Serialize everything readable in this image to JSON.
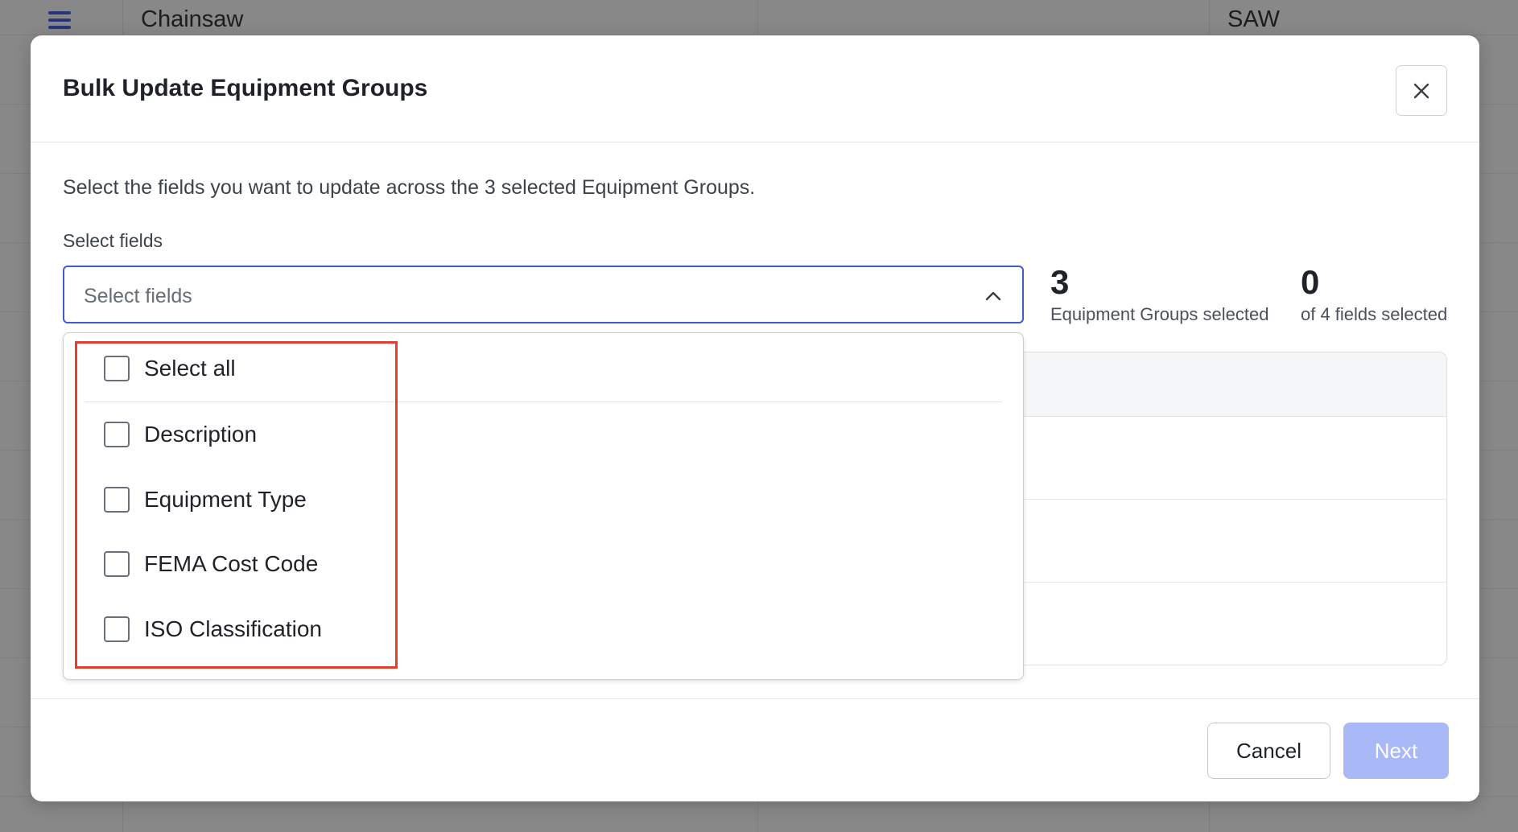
{
  "background": {
    "row_cells": [
      "Chainsaw",
      "SAW"
    ]
  },
  "modal": {
    "title": "Bulk Update Equipment Groups",
    "intro": "Select the fields you want to update across the 3 selected Equipment Groups.",
    "field_label": "Select fields",
    "select": {
      "placeholder": "Select fields"
    },
    "stats": [
      {
        "number": "3",
        "label": "Equipment Groups selected"
      },
      {
        "number": "0",
        "label": "of 4 fields selected"
      }
    ],
    "options": [
      {
        "label": "Select all",
        "checked": false
      },
      {
        "label": "Description",
        "checked": false
      },
      {
        "label": "Equipment Type",
        "checked": false
      },
      {
        "label": "FEMA Cost Code",
        "checked": false
      },
      {
        "label": "ISO Classification",
        "checked": false
      }
    ],
    "footer": {
      "cancel_label": "Cancel",
      "next_label": "Next"
    }
  },
  "colors": {
    "accent": "#3e5bd1",
    "next_disabled": "#a9b8f7",
    "highlight": "#e2402e"
  }
}
